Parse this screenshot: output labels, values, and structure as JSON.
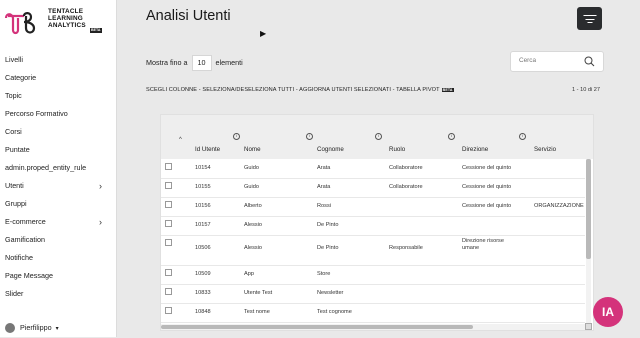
{
  "logo": {
    "line1": "TENTACLE",
    "line2": "LEARNING",
    "line3": "ANALYTICS",
    "beta": "BETA"
  },
  "sidebar": {
    "items": [
      {
        "label": "Livelli",
        "has_submenu": false
      },
      {
        "label": "Categorie",
        "has_submenu": false
      },
      {
        "label": "Topic",
        "has_submenu": false
      },
      {
        "label": "Percorso Formativo",
        "has_submenu": false
      },
      {
        "label": "Corsi",
        "has_submenu": false
      },
      {
        "label": "Puntate",
        "has_submenu": false
      },
      {
        "label": "admin.proped_entity_rule",
        "has_submenu": false
      },
      {
        "label": "Utenti",
        "has_submenu": true
      },
      {
        "label": "Gruppi",
        "has_submenu": false
      },
      {
        "label": "E-commerce",
        "has_submenu": true
      },
      {
        "label": "Gamification",
        "has_submenu": false
      },
      {
        "label": "Notifiche",
        "has_submenu": false
      },
      {
        "label": "Page Message",
        "has_submenu": false
      },
      {
        "label": "Slider",
        "has_submenu": false
      }
    ],
    "chevron": "›",
    "user": {
      "name": "Pierfilippo",
      "caret": "▾"
    }
  },
  "header": {
    "title": "Analisi Utenti"
  },
  "controls": {
    "show_prefix": "Mostra fino a",
    "page_size": "10",
    "show_suffix": "elementi",
    "search_placeholder": "Cerca"
  },
  "toolbar": {
    "text": "SCEGLI COLONNE - SELEZIONA/DESELEZIONA TUTTI - AGGIORNA UTENTI SELEZIONATI - TABELLA PIVOT",
    "beta": "BETA",
    "count": "1 - 10 di 27"
  },
  "table": {
    "columns": [
      "Id Utente",
      "Nome",
      "Cognome",
      "Ruolo",
      "Direzione",
      "Servizio"
    ],
    "sort_indicator": "^",
    "info_glyph": "i",
    "rows": [
      [
        "10154",
        "Guido",
        "Arata",
        "Collaboratore",
        "Cessione del quinto",
        ""
      ],
      [
        "10155",
        "Guido",
        "Arata",
        "Collaboratore",
        "Cessione del quinto",
        ""
      ],
      [
        "10156",
        "Alberto",
        "Rossi",
        "",
        "Cessione del quinto",
        "ORGANIZZAZIONE"
      ],
      [
        "10157",
        "Alessio",
        "De Pinto",
        "",
        "",
        ""
      ],
      [
        "10506",
        "Alessio",
        "De Pinto",
        "Responsabile",
        "Direzione risorse umane",
        ""
      ],
      [
        "10509",
        "App",
        "Store",
        "",
        "",
        ""
      ],
      [
        "10833",
        "Utente Test",
        "Newsletter",
        "",
        "",
        ""
      ],
      [
        "10848",
        "Test nome",
        "Test cognome",
        "",
        "",
        ""
      ]
    ]
  },
  "badge": {
    "text": "IA"
  },
  "colors": {
    "accent": "#d4337b",
    "filter_button": "#2a2c2e",
    "sidebar_bg": "#ffffff",
    "page_bg": "#e9e9e9"
  },
  "icons": {
    "filter": "filter-lines-icon",
    "search": "magnifier-icon",
    "logo": "tentacle-logo-mark"
  }
}
